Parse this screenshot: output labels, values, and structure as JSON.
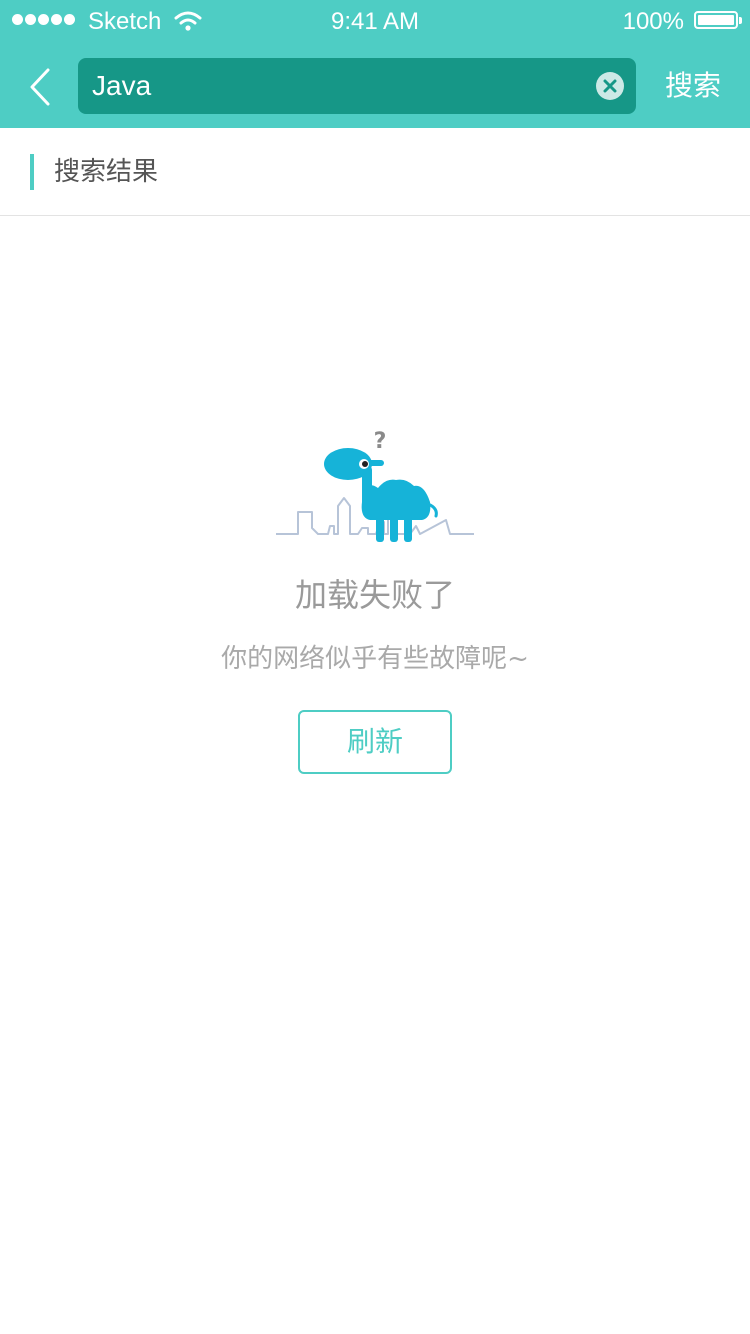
{
  "status_bar": {
    "carrier": "Sketch",
    "time": "9:41 AM",
    "battery": "100%"
  },
  "search": {
    "query": "Java",
    "button_label": "搜索"
  },
  "section": {
    "title": "搜索结果"
  },
  "error": {
    "title": "加载失败了",
    "subtitle": "你的网络似乎有些故障呢~",
    "refresh_label": "刷新"
  },
  "colors": {
    "accent": "#4ecdc4",
    "search_field": "#169787",
    "camel": "#16b3d8"
  },
  "icons": {
    "back": "chevron-left-icon",
    "clear": "clear-circle-icon",
    "wifi": "wifi-icon",
    "battery": "battery-icon"
  }
}
